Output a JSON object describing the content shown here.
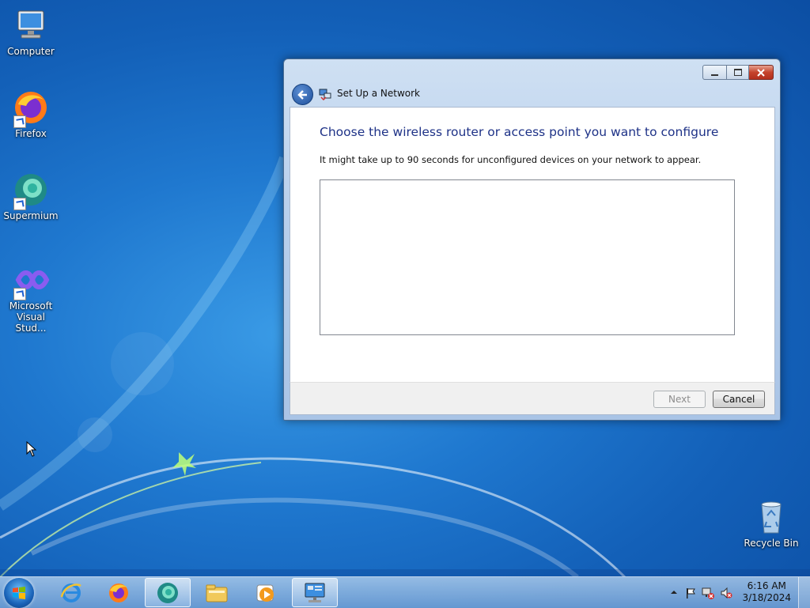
{
  "desktop": {
    "icons": [
      {
        "label": "Computer",
        "icon": "computer-icon"
      },
      {
        "label": "Firefox",
        "icon": "firefox-icon"
      },
      {
        "label": "Supermium",
        "icon": "supermium-icon"
      },
      {
        "label": "Microsoft Visual Stud...",
        "icon": "visual-studio-icon"
      },
      {
        "label": "Recycle Bin",
        "icon": "recycle-bin-icon"
      }
    ]
  },
  "window": {
    "title": "Set Up a Network",
    "heading": "Choose the wireless router or access point you want to configure",
    "description": "It might take up to 90 seconds for unconfigured devices on your network to appear.",
    "devices": [],
    "buttons": {
      "next": "Next",
      "cancel": "Cancel"
    },
    "next_enabled": false
  },
  "taskbar": {
    "items": [
      {
        "icon": "internet-explorer-icon",
        "active": false
      },
      {
        "icon": "firefox-icon",
        "active": false
      },
      {
        "icon": "supermium-icon",
        "active": true
      },
      {
        "icon": "file-explorer-icon",
        "active": false
      },
      {
        "icon": "media-player-icon",
        "active": false
      },
      {
        "icon": "network-setup-icon",
        "active": true
      }
    ],
    "clock": {
      "time": "6:16 AM",
      "date": "3/18/2024"
    }
  },
  "colors": {
    "heading": "#1e3287",
    "close_button": "#c5432c",
    "desktop_blue": "#1f78cf"
  }
}
